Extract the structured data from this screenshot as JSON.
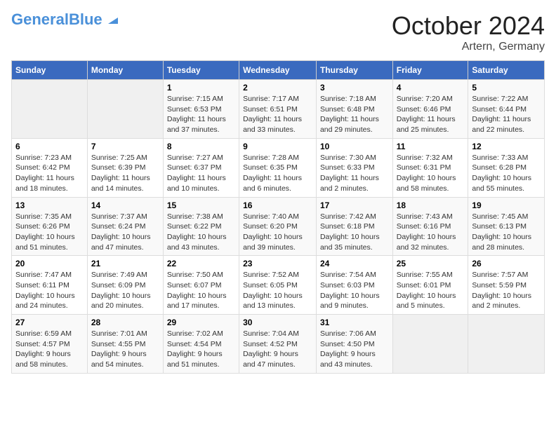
{
  "header": {
    "logo_general": "General",
    "logo_blue": "Blue",
    "month_title": "October 2024",
    "location": "Artern, Germany"
  },
  "days_of_week": [
    "Sunday",
    "Monday",
    "Tuesday",
    "Wednesday",
    "Thursday",
    "Friday",
    "Saturday"
  ],
  "weeks": [
    [
      {
        "day": "",
        "details": ""
      },
      {
        "day": "",
        "details": ""
      },
      {
        "day": "1",
        "details": "Sunrise: 7:15 AM\nSunset: 6:53 PM\nDaylight: 11 hours\nand 37 minutes."
      },
      {
        "day": "2",
        "details": "Sunrise: 7:17 AM\nSunset: 6:51 PM\nDaylight: 11 hours\nand 33 minutes."
      },
      {
        "day": "3",
        "details": "Sunrise: 7:18 AM\nSunset: 6:48 PM\nDaylight: 11 hours\nand 29 minutes."
      },
      {
        "day": "4",
        "details": "Sunrise: 7:20 AM\nSunset: 6:46 PM\nDaylight: 11 hours\nand 25 minutes."
      },
      {
        "day": "5",
        "details": "Sunrise: 7:22 AM\nSunset: 6:44 PM\nDaylight: 11 hours\nand 22 minutes."
      }
    ],
    [
      {
        "day": "6",
        "details": "Sunrise: 7:23 AM\nSunset: 6:42 PM\nDaylight: 11 hours\nand 18 minutes."
      },
      {
        "day": "7",
        "details": "Sunrise: 7:25 AM\nSunset: 6:39 PM\nDaylight: 11 hours\nand 14 minutes."
      },
      {
        "day": "8",
        "details": "Sunrise: 7:27 AM\nSunset: 6:37 PM\nDaylight: 11 hours\nand 10 minutes."
      },
      {
        "day": "9",
        "details": "Sunrise: 7:28 AM\nSunset: 6:35 PM\nDaylight: 11 hours\nand 6 minutes."
      },
      {
        "day": "10",
        "details": "Sunrise: 7:30 AM\nSunset: 6:33 PM\nDaylight: 11 hours\nand 2 minutes."
      },
      {
        "day": "11",
        "details": "Sunrise: 7:32 AM\nSunset: 6:31 PM\nDaylight: 10 hours\nand 58 minutes."
      },
      {
        "day": "12",
        "details": "Sunrise: 7:33 AM\nSunset: 6:28 PM\nDaylight: 10 hours\nand 55 minutes."
      }
    ],
    [
      {
        "day": "13",
        "details": "Sunrise: 7:35 AM\nSunset: 6:26 PM\nDaylight: 10 hours\nand 51 minutes."
      },
      {
        "day": "14",
        "details": "Sunrise: 7:37 AM\nSunset: 6:24 PM\nDaylight: 10 hours\nand 47 minutes."
      },
      {
        "day": "15",
        "details": "Sunrise: 7:38 AM\nSunset: 6:22 PM\nDaylight: 10 hours\nand 43 minutes."
      },
      {
        "day": "16",
        "details": "Sunrise: 7:40 AM\nSunset: 6:20 PM\nDaylight: 10 hours\nand 39 minutes."
      },
      {
        "day": "17",
        "details": "Sunrise: 7:42 AM\nSunset: 6:18 PM\nDaylight: 10 hours\nand 35 minutes."
      },
      {
        "day": "18",
        "details": "Sunrise: 7:43 AM\nSunset: 6:16 PM\nDaylight: 10 hours\nand 32 minutes."
      },
      {
        "day": "19",
        "details": "Sunrise: 7:45 AM\nSunset: 6:13 PM\nDaylight: 10 hours\nand 28 minutes."
      }
    ],
    [
      {
        "day": "20",
        "details": "Sunrise: 7:47 AM\nSunset: 6:11 PM\nDaylight: 10 hours\nand 24 minutes."
      },
      {
        "day": "21",
        "details": "Sunrise: 7:49 AM\nSunset: 6:09 PM\nDaylight: 10 hours\nand 20 minutes."
      },
      {
        "day": "22",
        "details": "Sunrise: 7:50 AM\nSunset: 6:07 PM\nDaylight: 10 hours\nand 17 minutes."
      },
      {
        "day": "23",
        "details": "Sunrise: 7:52 AM\nSunset: 6:05 PM\nDaylight: 10 hours\nand 13 minutes."
      },
      {
        "day": "24",
        "details": "Sunrise: 7:54 AM\nSunset: 6:03 PM\nDaylight: 10 hours\nand 9 minutes."
      },
      {
        "day": "25",
        "details": "Sunrise: 7:55 AM\nSunset: 6:01 PM\nDaylight: 10 hours\nand 5 minutes."
      },
      {
        "day": "26",
        "details": "Sunrise: 7:57 AM\nSunset: 5:59 PM\nDaylight: 10 hours\nand 2 minutes."
      }
    ],
    [
      {
        "day": "27",
        "details": "Sunrise: 6:59 AM\nSunset: 4:57 PM\nDaylight: 9 hours\nand 58 minutes."
      },
      {
        "day": "28",
        "details": "Sunrise: 7:01 AM\nSunset: 4:55 PM\nDaylight: 9 hours\nand 54 minutes."
      },
      {
        "day": "29",
        "details": "Sunrise: 7:02 AM\nSunset: 4:54 PM\nDaylight: 9 hours\nand 51 minutes."
      },
      {
        "day": "30",
        "details": "Sunrise: 7:04 AM\nSunset: 4:52 PM\nDaylight: 9 hours\nand 47 minutes."
      },
      {
        "day": "31",
        "details": "Sunrise: 7:06 AM\nSunset: 4:50 PM\nDaylight: 9 hours\nand 43 minutes."
      },
      {
        "day": "",
        "details": ""
      },
      {
        "day": "",
        "details": ""
      }
    ]
  ]
}
